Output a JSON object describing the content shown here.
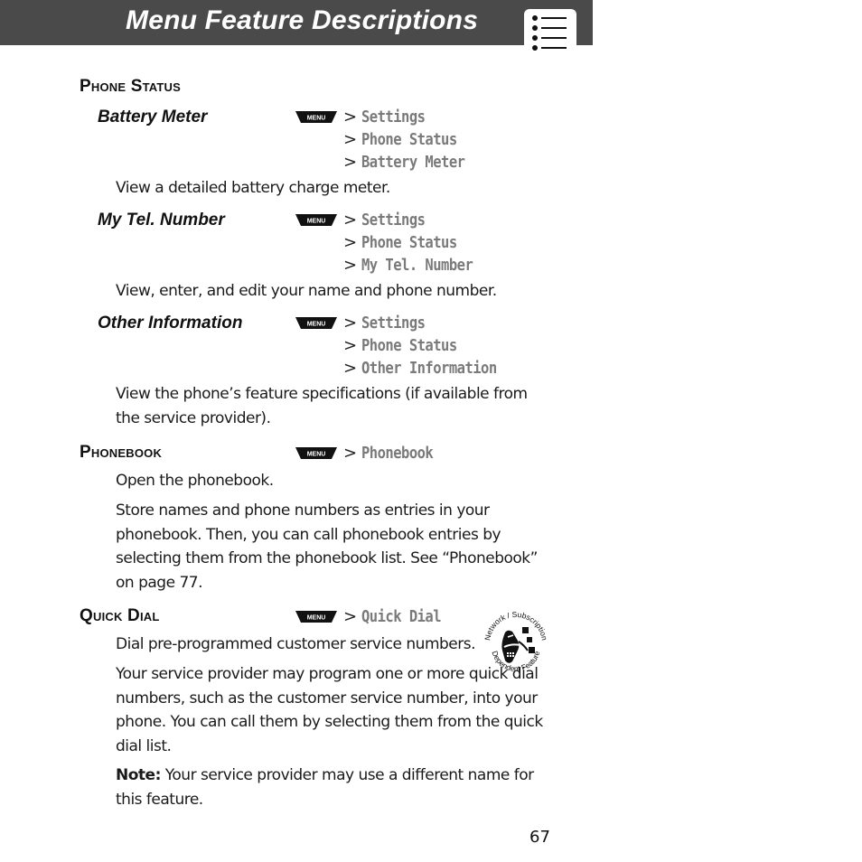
{
  "header": {
    "title": "Menu Feature Descriptions",
    "icon": "menu-list-icon"
  },
  "sections": {
    "phone_status": {
      "heading": "Phone Status",
      "items": [
        {
          "title": "Battery Meter",
          "key": "MENU",
          "path": [
            "Settings",
            "Phone Status",
            "Battery Meter"
          ],
          "description": "View a detailed battery charge meter."
        },
        {
          "title": "My Tel. Number",
          "key": "MENU",
          "path": [
            "Settings",
            "Phone Status",
            "My Tel. Number"
          ],
          "description": "View, enter, and edit your name and phone number."
        },
        {
          "title": "Other Information",
          "key": "MENU",
          "path": [
            "Settings",
            "Phone Status",
            "Other Information"
          ],
          "description": "View the phone’s feature specifications (if available from the service provider)."
        }
      ]
    },
    "phonebook": {
      "heading": "Phonebook",
      "key": "MENU",
      "path": [
        "Phonebook"
      ],
      "paragraphs": [
        "Open the phonebook.",
        "Store names and phone numbers as entries in your phonebook. Then, you can call phonebook entries by selecting them from the phonebook list. See “Phonebook” on page 77."
      ]
    },
    "quick_dial": {
      "heading": "Quick Dial",
      "key": "MENU",
      "path": [
        "Quick Dial"
      ],
      "paragraphs": [
        "Dial pre-programmed customer service numbers.",
        "Your service provider may program one or more quick dial numbers, such as the customer service number, into your phone. You can call them by selecting them from the quick dial list."
      ],
      "note_label": "Note:",
      "note_text": " Your service provider may use a different name for this feature.",
      "badge": {
        "icon": "network-subscription-dependent-feature-icon",
        "top_text": "Network / Subscription",
        "bottom_text": "Dependent Feature"
      }
    }
  },
  "separator": ">",
  "page_number": "67"
}
